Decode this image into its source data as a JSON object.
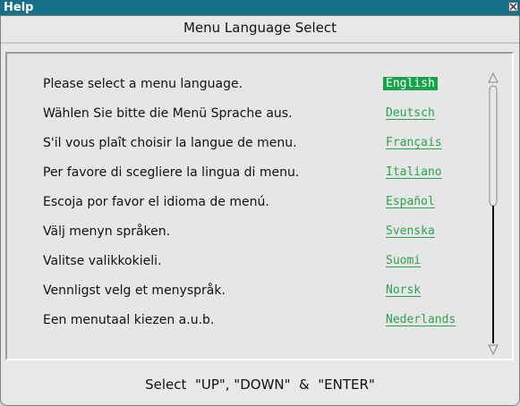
{
  "window": {
    "title": "Help"
  },
  "dialog": {
    "heading": "Menu Language Select",
    "rows": [
      {
        "text": "Please select a menu language.",
        "language": "English",
        "selected": true
      },
      {
        "text": "Wählen Sie bitte die Menü Sprache aus.",
        "language": "Deutsch",
        "selected": false
      },
      {
        "text": "S'il vous plaît choisir la langue de menu.",
        "language": "Français",
        "selected": false
      },
      {
        "text": "Per favore di scegliere la lingua di menu.",
        "language": "Italiano",
        "selected": false
      },
      {
        "text": "Escoja por favor el idioma de menú.",
        "language": "Español",
        "selected": false
      },
      {
        "text": "Välj menyn språken.",
        "language": "Svenska",
        "selected": false
      },
      {
        "text": "Valitse valikkokieli.",
        "language": "Suomi",
        "selected": false
      },
      {
        "text": "Vennligst velg et menyspråk.",
        "language": "Norsk",
        "selected": false
      },
      {
        "text": "Een menutaal kiezen a.u.b.",
        "language": "Nederlands",
        "selected": false
      }
    ],
    "footer": "Select  \"UP\", \"DOWN\"  &  \"ENTER\""
  },
  "icons": {
    "close": "close-icon",
    "scroll_up": "scroll-up-arrow-icon",
    "scroll_down": "scroll-down-arrow-icon"
  },
  "colors": {
    "titlebar": "#17708a",
    "selected_bg": "#16a34a",
    "language_text": "#2aa44f"
  }
}
